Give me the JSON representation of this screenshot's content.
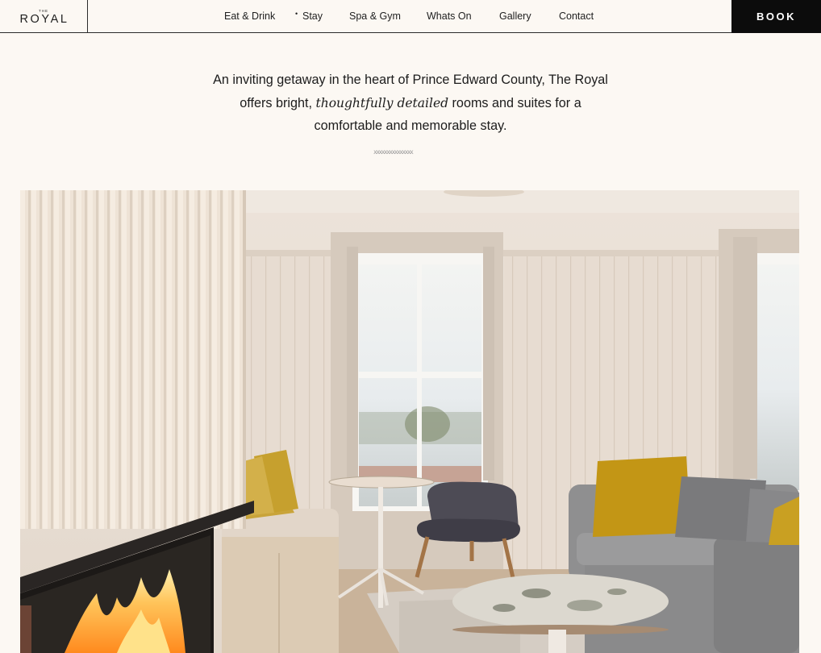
{
  "header": {
    "logo_small": "THE",
    "logo_main": "ROYAL",
    "nav": {
      "eat_drink": "Eat & Drink",
      "stay_marker": "•",
      "stay": "Stay",
      "spa_gym": "Spa & Gym",
      "whats_on": "Whats On",
      "gallery": "Gallery",
      "contact": "Contact"
    },
    "book_label": "BOOK"
  },
  "intro": {
    "text_before": "An inviting getaway in the heart of Prince Edward County, The Royal offers bright,",
    "text_emphasis": "thoughtfully detailed",
    "text_after": "rooms and suites for a comfortable and memorable stay.",
    "divider": "xxxxxxxxxxxxxxx"
  },
  "photo": {
    "subject": "hotel-room-interior-photo"
  },
  "colors": {
    "background": "#fcf8f3",
    "text": "#1e1e1e",
    "book_bg": "#0c0c0c",
    "book_text": "#ffffff",
    "accent_mustard": "#c49a1f"
  }
}
